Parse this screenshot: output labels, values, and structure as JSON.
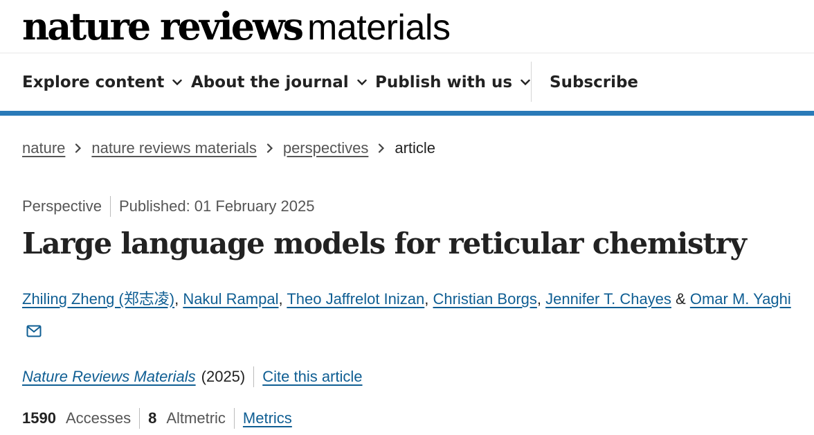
{
  "masthead": {
    "brand": "nature reviews",
    "subtitle": "materials"
  },
  "nav": {
    "items": [
      {
        "label": "Explore content"
      },
      {
        "label": "About the journal"
      },
      {
        "label": "Publish with us"
      }
    ],
    "subscribe": "Subscribe"
  },
  "colors": {
    "accent_bar": "#2a7ab8",
    "link": "#0f5e93",
    "text": "#222222",
    "muted_text": "#555555"
  },
  "breadcrumb": {
    "items": [
      "nature",
      "nature reviews materials",
      "perspectives"
    ],
    "current": "article"
  },
  "article": {
    "type": "Perspective",
    "published": "Published: 01 February 2025",
    "title": "Large language models for reticular chemistry",
    "authors": [
      "Zhiling Zheng  (郑志凌)",
      "Nakul Rampal",
      "Theo Jaffrelot Inizan",
      "Christian Borgs",
      "Jennifer T. Chayes",
      "Omar M. Yaghi"
    ],
    "author_separator": ", ",
    "author_last_separator": " & ",
    "corresponding_icon": "mail-icon",
    "journal": "Nature Reviews Materials",
    "year": "(2025)",
    "cite_label": "Cite this article"
  },
  "metrics": {
    "accesses_value": "1590",
    "accesses_label": "Accesses",
    "altmetric_value": "8",
    "altmetric_label": "Altmetric",
    "metrics_link": "Metrics"
  }
}
